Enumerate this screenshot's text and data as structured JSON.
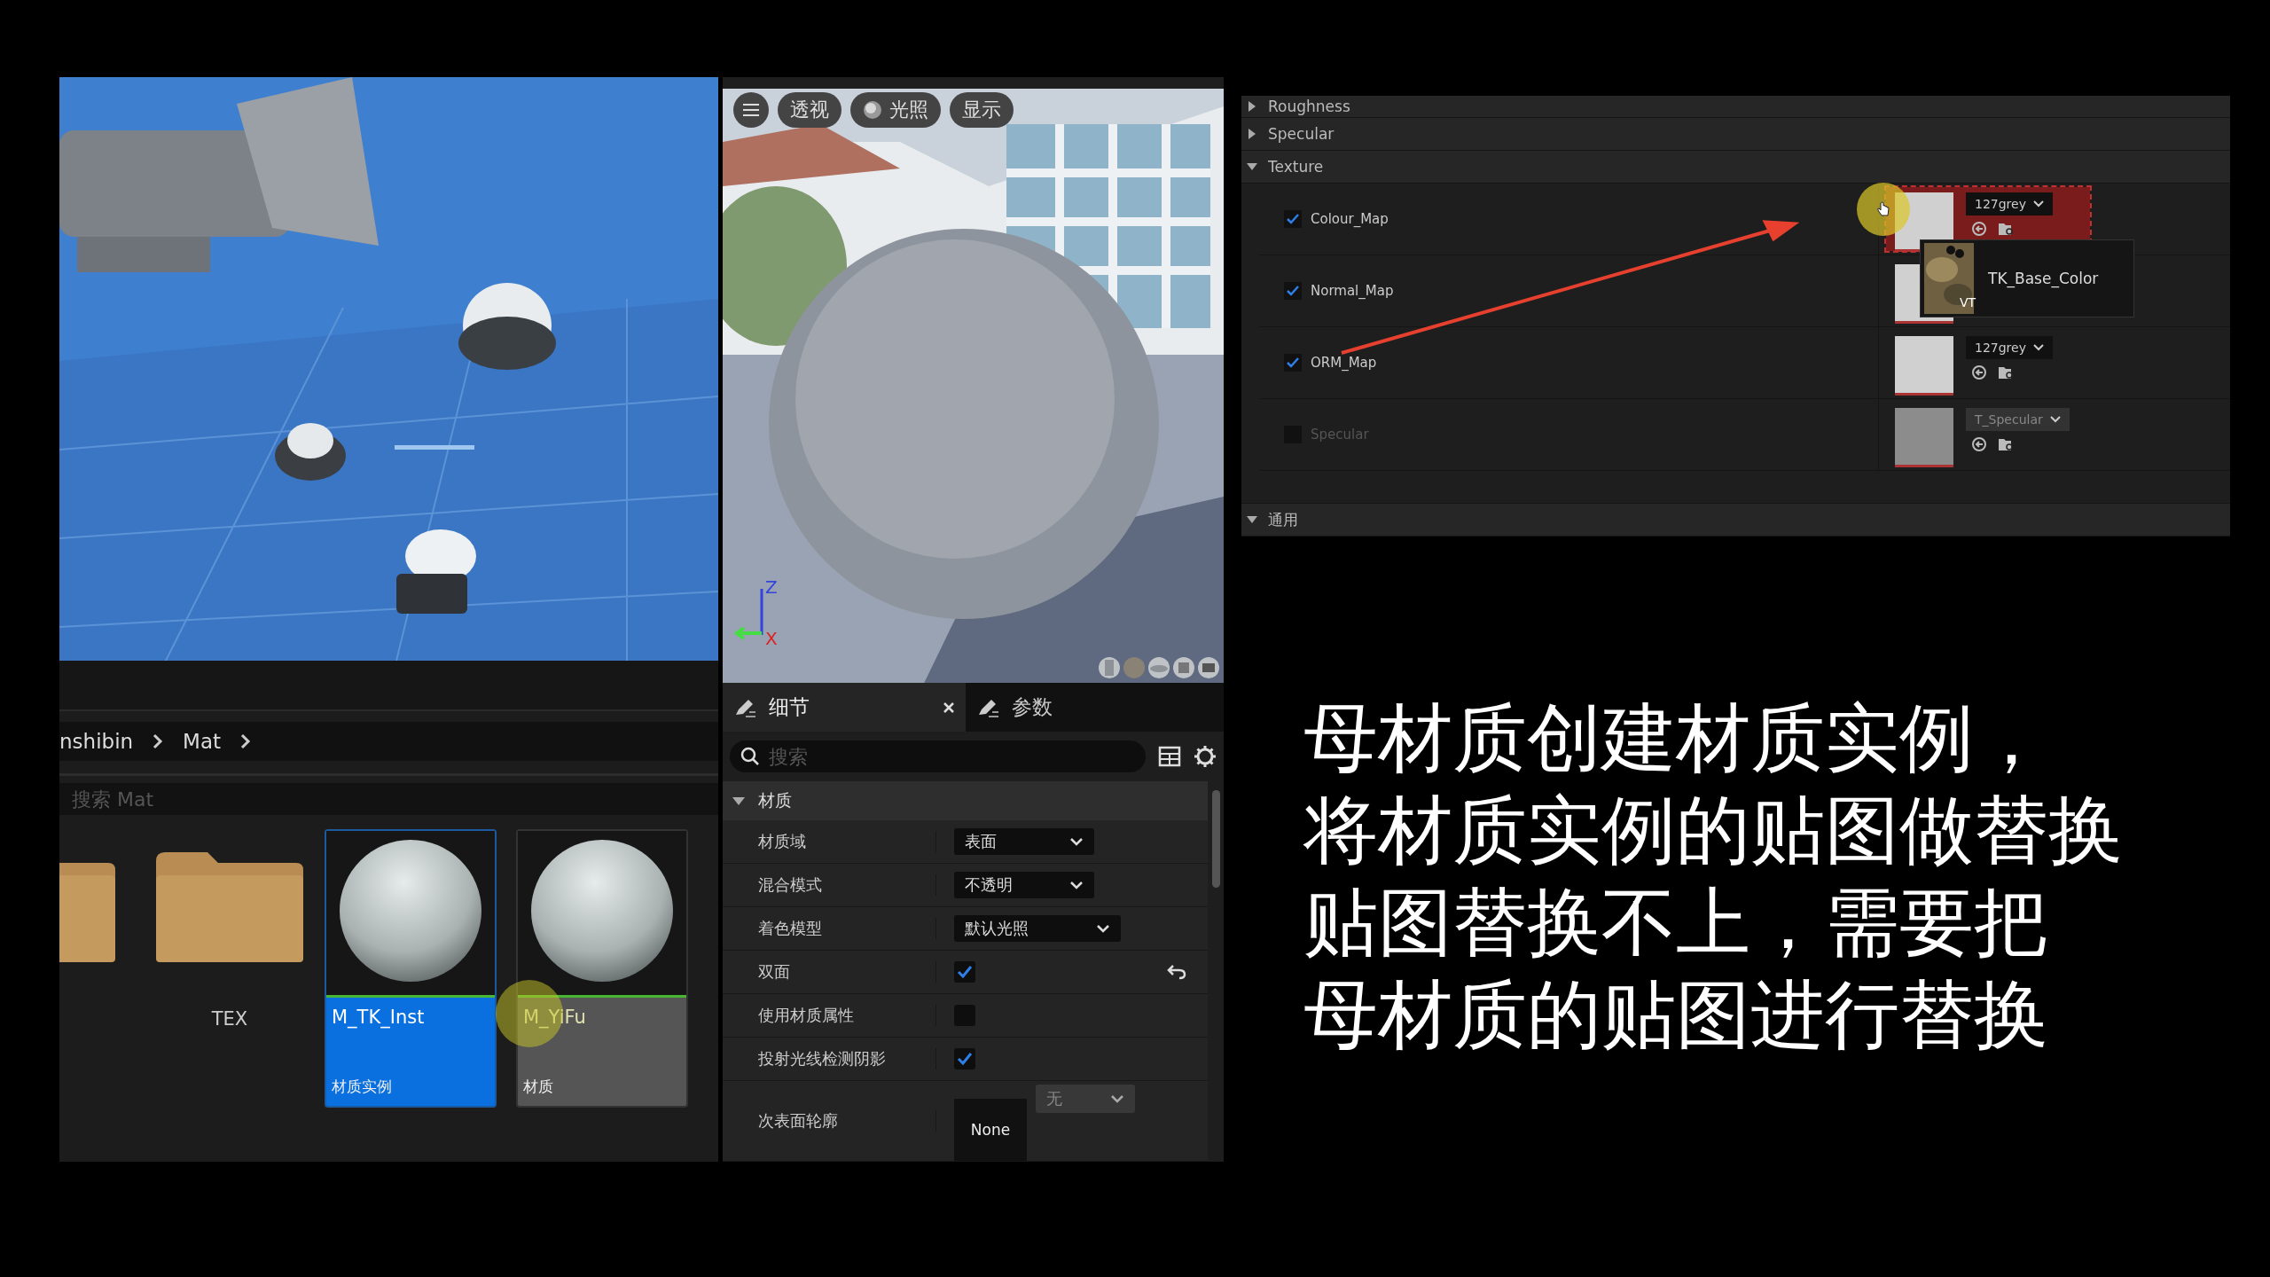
{
  "content_browser": {
    "breadcrumb": [
      "nshibin",
      "Mat"
    ],
    "search": {
      "placeholder": "搜索 Mat"
    },
    "assets": [
      {
        "kind": "folder",
        "selected": false
      },
      {
        "kind": "folder",
        "name": "TEX",
        "selected": false
      },
      {
        "kind": "material",
        "name": "M_TK_Inst",
        "type": "材质实例",
        "selected": true
      },
      {
        "kind": "material",
        "name": "M_YiFu",
        "type": "材质",
        "selected": false
      }
    ]
  },
  "material_preview": {
    "toolbar": [
      {
        "label": "透视",
        "icon": false
      },
      {
        "label": "光照",
        "icon": true
      },
      {
        "label": "显示",
        "icon": false
      }
    ],
    "axes": [
      "Z",
      "X"
    ]
  },
  "details": {
    "tabs": [
      {
        "label": "细节",
        "selected": true,
        "closable": true
      },
      {
        "label": "参数",
        "selected": false,
        "closable": false
      }
    ],
    "search": {
      "placeholder": "搜索"
    },
    "category": {
      "label": "材质",
      "expanded": true
    },
    "properties": [
      {
        "kind": "dropdown",
        "label": "材质域",
        "value": "表面"
      },
      {
        "kind": "dropdown",
        "label": "混合模式",
        "value": "不透明"
      },
      {
        "kind": "dropdown",
        "label": "着色模型",
        "value": "默认光照"
      },
      {
        "kind": "checkbox",
        "label": "双面",
        "checked": true,
        "reset": true
      },
      {
        "kind": "checkbox",
        "label": "使用材质属性",
        "checked": false,
        "reset": false
      },
      {
        "kind": "checkbox",
        "label": "投射光线检测阴影",
        "checked": true,
        "reset": false
      },
      {
        "kind": "asset",
        "label": "次表面轮廓",
        "thumbnail": "None",
        "value": "无",
        "disabled": true
      }
    ]
  },
  "parameters": {
    "categories": [
      {
        "label": "Roughness",
        "expanded": false
      },
      {
        "label": "Specular",
        "expanded": false
      },
      {
        "label": "Texture",
        "expanded": true,
        "params": [
          {
            "name": "Colour_Map",
            "checked": true,
            "value": "127grey",
            "highlighted": true
          },
          {
            "name": "Normal_Map",
            "checked": true,
            "highlighted": false
          },
          {
            "name": "ORM_Map",
            "checked": true,
            "value": "127grey",
            "highlighted": false
          },
          {
            "name": "Specular",
            "checked": false,
            "value": "T_Specular",
            "highlighted": false
          }
        ]
      },
      {
        "label": "通用",
        "expanded": true
      }
    ],
    "tooltip": {
      "label": "TK_Base_Color",
      "badge": "VT"
    }
  },
  "caption": {
    "lines": [
      "母材质创建材质实例，",
      "将材质实例的贴图做替换",
      "贴图替换不上，需要把",
      "母材质的贴图进行替换"
    ]
  }
}
